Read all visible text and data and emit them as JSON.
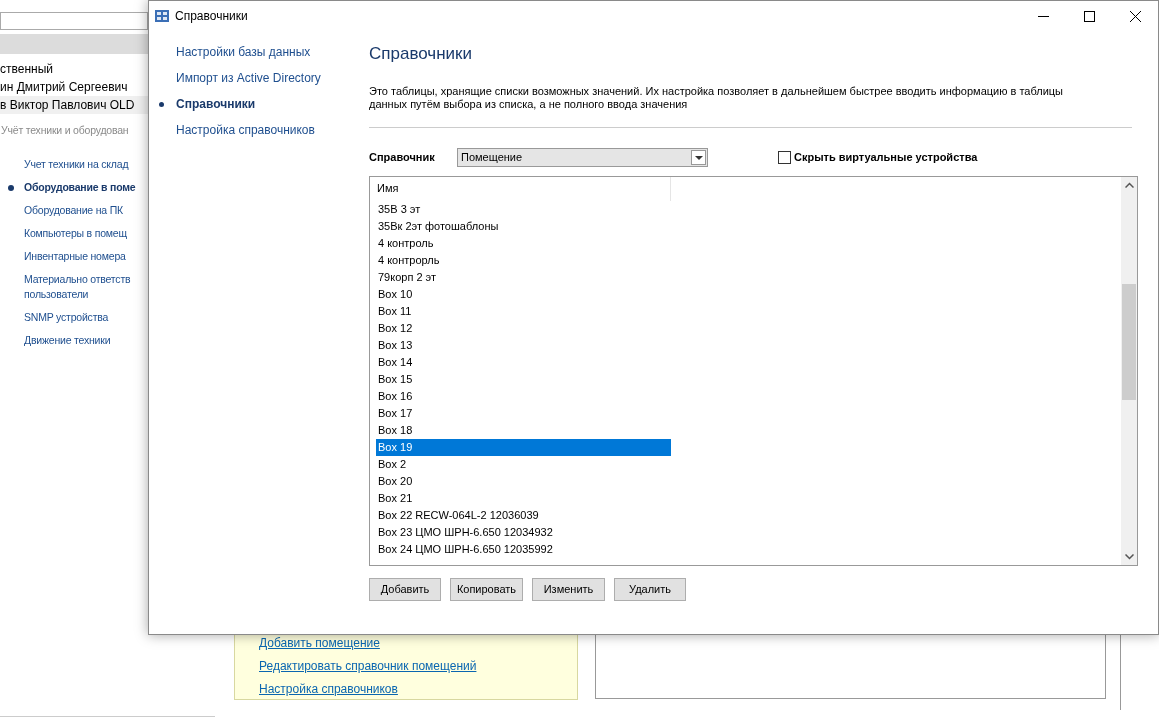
{
  "background_app": {
    "user_rows": [
      {
        "name": "ственный",
        "selected": false
      },
      {
        "name": "ин Дмитрий Сергеевич",
        "selected": false
      },
      {
        "name": "в Виктор Павлович OLD",
        "selected": true
      }
    ],
    "section_title": "Учёт техники и оборудован",
    "nav_items": [
      {
        "label": "Учет техники на склад",
        "selected": false
      },
      {
        "label": "Оборудование в поме",
        "selected": true
      },
      {
        "label": "Оборудование на ПК",
        "selected": false
      },
      {
        "label": "Компьютеры в помещ",
        "selected": false
      },
      {
        "label": "Инвентарные номера",
        "selected": false
      },
      {
        "label": "Материально ответств пользователи",
        "selected": false
      },
      {
        "label": "SNMP устройства",
        "selected": false
      },
      {
        "label": "Движение техники",
        "selected": false
      }
    ],
    "links": [
      "Добавить помещение",
      "Редактировать справочник помещений",
      "Настройка справочников"
    ]
  },
  "dialog": {
    "title": "Справочники",
    "nav_items": [
      {
        "label": "Настройки базы данных",
        "selected": false
      },
      {
        "label": "Импорт из Active Directory",
        "selected": false
      },
      {
        "label": "Справочники",
        "selected": true
      },
      {
        "label": "Настройка справочников",
        "selected": false
      }
    ],
    "heading": "Справочники",
    "description": "Это таблицы, хранящие списки возможных значений. Их настройка позволяет в дальнейшем быстрее вводить информацию в таблицы данных путём выбора из списка, а не полного ввода значения",
    "dictionary_label": "Справочник",
    "dictionary_value": "Помещение",
    "hide_virtual": {
      "label": "Скрыть виртуальные устройства",
      "checked": false
    },
    "table": {
      "columns": [
        "Имя"
      ],
      "rows": [
        {
          "name": "35В 3 эт",
          "selected": false
        },
        {
          "name": "35Вк 2эт фотошаблоны",
          "selected": false
        },
        {
          "name": "4 контроль",
          "selected": false
        },
        {
          "name": "4 контрорль",
          "selected": false
        },
        {
          "name": "79корп 2 эт",
          "selected": false
        },
        {
          "name": "Box 10",
          "selected": false
        },
        {
          "name": "Box 11",
          "selected": false
        },
        {
          "name": "Box 12",
          "selected": false
        },
        {
          "name": "Box 13",
          "selected": false
        },
        {
          "name": "Box 14",
          "selected": false
        },
        {
          "name": "Box 15",
          "selected": false
        },
        {
          "name": "Box 16",
          "selected": false
        },
        {
          "name": "Box 17",
          "selected": false
        },
        {
          "name": "Box 18",
          "selected": false
        },
        {
          "name": "Box 19",
          "selected": true
        },
        {
          "name": "Box 2",
          "selected": false
        },
        {
          "name": "Box 20",
          "selected": false
        },
        {
          "name": "Box 21",
          "selected": false
        },
        {
          "name": "Box 22  RECW-064L-2 12036039",
          "selected": false
        },
        {
          "name": "Box 23 ЦМО ШРН-6.650 12034932",
          "selected": false
        },
        {
          "name": "Box 24 ЦМО ШРН-6.650 12035992",
          "selected": false
        }
      ]
    },
    "buttons": [
      "Добавить",
      "Копировать",
      "Изменить",
      "Удалить"
    ]
  }
}
